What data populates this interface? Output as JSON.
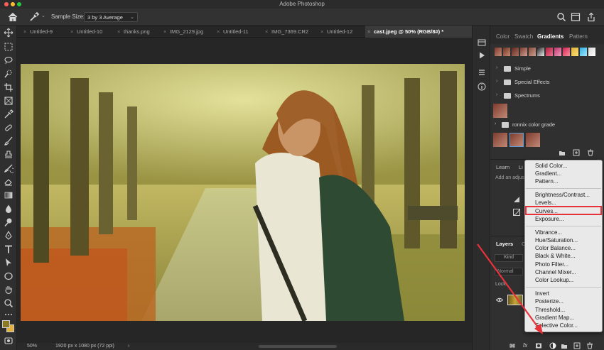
{
  "window": {
    "title": "Adobe Photoshop"
  },
  "options_bar": {
    "sample_size_label": "Sample Size:",
    "sample_size_value": "3 by 3 Average"
  },
  "doc_tabs": [
    {
      "label": "Untitled-9",
      "active": false
    },
    {
      "label": "Untitled-10",
      "active": false
    },
    {
      "label": "thanks.png",
      "active": false
    },
    {
      "label": "IMG_2129.jpg",
      "active": false
    },
    {
      "label": "Untitled-11",
      "active": false
    },
    {
      "label": "IMG_7369.CR2",
      "active": false
    },
    {
      "label": "Untitled-12",
      "active": false
    },
    {
      "label": "cast.jpeg @ 50% (RGB/8#) *",
      "active": true
    }
  ],
  "status": {
    "zoom": "50%",
    "dimensions": "1920 px x 1080 px (72 ppi)",
    "arrow": "›"
  },
  "panel_tabs": [
    "Color",
    "Swatch",
    "Gradients",
    "Pattern"
  ],
  "active_panel_tab": "Gradients",
  "gradient_folders": [
    {
      "label": "Simple"
    },
    {
      "label": "Special Effects"
    },
    {
      "label": "Spectrums"
    }
  ],
  "gradient_group": {
    "label": "ronnix color grade"
  },
  "learn_tabs": [
    "Learn",
    "Li"
  ],
  "adjustments_hint": "Add an adjus",
  "layers_panel": {
    "tab": "Layers",
    "tab2": "C",
    "kind_label": "Kind",
    "blend_mode": "Normal",
    "lock_label": "Lock:"
  },
  "adjustment_menu": {
    "groups": [
      [
        "Solid Color...",
        "Gradient...",
        "Pattern..."
      ],
      [
        "Brightness/Contrast...",
        "Levels...",
        "Curves...",
        "Exposure..."
      ],
      [
        "Vibrance...",
        "Hue/Saturation...",
        "Color Balance...",
        "Black & White...",
        "Photo Filter...",
        "Channel Mixer...",
        "Color Lookup..."
      ],
      [
        "Invert",
        "Posterize...",
        "Threshold...",
        "Gradient Map...",
        "Selective Color..."
      ]
    ],
    "highlighted": "Curves..."
  },
  "colors": {
    "accent_red": "#e8323a",
    "foreground_swatch": "#8c7a24",
    "background_swatch": "#e3b13c",
    "menu_bg": "#e9e9e9"
  }
}
